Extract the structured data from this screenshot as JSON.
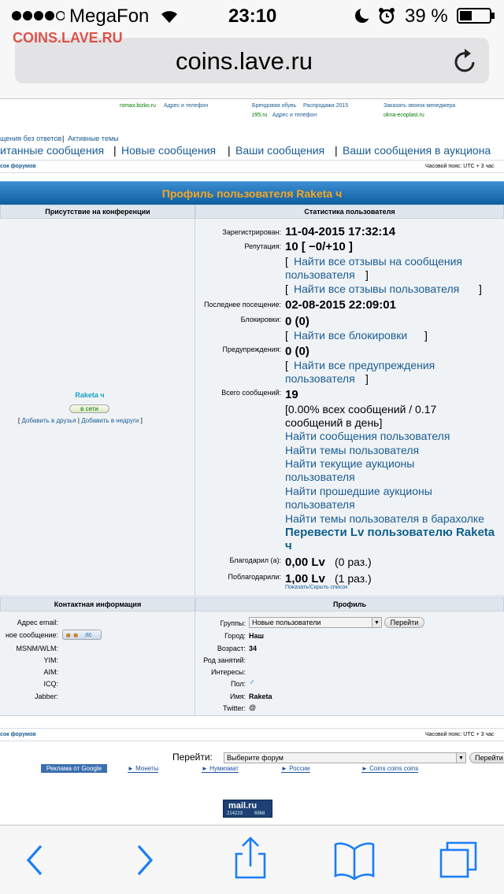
{
  "status_bar": {
    "carrier": "MegaFon",
    "time": "23:10",
    "battery": "39 %"
  },
  "site_watermark": "COINS.LAVE.RU",
  "url": "coins.lave.ru",
  "ads": {
    "col1_line1": "romax.bizko.ru",
    "col1_line1b": "Адрес и телефон",
    "col2_line1": "Брендовая обувь",
    "col2_line1b": "Распродажа 2015",
    "col2_line2": "z95.ru",
    "col2_line2b": "Адрес и телефон",
    "col3_line1": "Заказать звонок менеджера",
    "col3_line2": "okna-ecoplast.ru"
  },
  "nav": {
    "small_links": [
      "щения без ответов",
      "Активные темы"
    ],
    "big_links": [
      "итанные сообщения",
      "Новые сообщения",
      "Ваши сообщения",
      "Ваши сообщения в аукциона"
    ],
    "forum_list": "сок форумов",
    "timezone": "Часовой пояс: UTC + 3 час"
  },
  "profile": {
    "banner": "Профиль пользователя Raketa ч",
    "col_left_header": "Присутствие на конференции",
    "col_right_header": "Статистика пользователя",
    "username": "Raketa ч",
    "online_button": "в сети",
    "add_friend": "Добавить в друзья",
    "add_foe": "Добавить в недруги"
  },
  "stats": {
    "registered_label": "Зарегистрирован:",
    "registered_value": "11-04-2015 17:32:14",
    "reputation_label": "Репутация:",
    "reputation_value": "10 [ −0/+10 ]",
    "rep_link1_a": "Найти все отзывы на сообщения",
    "rep_link1_b": "пользователя",
    "rep_link2": "Найти все отзывы пользователя",
    "last_visit_label": "Последнее посещение:",
    "last_visit_value": "02-08-2015 22:09:01",
    "bans_label": "Блокировки:",
    "bans_value": "0 (0)",
    "bans_link": "Найти все блокировки",
    "warnings_label": "Предупреждения:",
    "warnings_value": "0 (0)",
    "warn_link_a": "Найти все предупреждения",
    "warn_link_b": "пользователя",
    "posts_label": "Всего сообщений:",
    "posts_value": "19",
    "posts_pct_a": "[0.00% всех сообщений / 0.17",
    "posts_pct_b": "сообщений в день]",
    "find_posts": "Найти сообщения пользователя",
    "find_topics": "Найти темы пользователя",
    "find_cur_auctions_a": "Найти текущие аукционы",
    "find_cur_auctions_b": "пользователя",
    "find_past_auctions_a": "Найти прошедшие аукционы",
    "find_past_auctions_b": "пользователя",
    "find_flea": "Найти темы пользователя в барахолке",
    "transfer_a": "Перевести Lv пользователю Raketa",
    "transfer_b": "ч",
    "thanked_label": "Благодарил (а):",
    "thanked_value": "0,00 Lv",
    "thanked_count": "(0 раз.)",
    "was_thanked_label": "Поблагодарили:",
    "was_thanked_value": "1,00 Lv",
    "was_thanked_count": "(1 раз.)",
    "show_hide": "Показать/Скрыть список"
  },
  "contact": {
    "header": "Контактная информация",
    "email": "Адрес email:",
    "pm": "ное сообщение:",
    "pm_button": "лс",
    "msnm": "MSNM/WLM:",
    "yim": "YIM:",
    "aim": "AIM:",
    "icq": "ICQ:",
    "jabber": "Jabber:"
  },
  "profile_info": {
    "header": "Профиль",
    "groups_label": "Группы:",
    "groups_value": "Новые пользователи",
    "go_button": "Перейти",
    "city_label": "Город:",
    "city_value": "Наш",
    "age_label": "Возраст:",
    "age_value": "34",
    "occupation_label": "Род занятий:",
    "interests_label": "Интересы:",
    "gender_label": "Пол:",
    "name_label": "Имя:",
    "name_value": "Raketa",
    "twitter_label": "Twitter:"
  },
  "footer": {
    "forum_list": "сок форумов",
    "timezone": "Часовой пояс: UTC + 3 час",
    "jump_label": "Перейти:",
    "jump_select": "Выберите форум",
    "jump_button": "Перейти",
    "google_ads": "Реклама от Google",
    "ad_links": [
      "► Монеты",
      "► Нумизмат",
      "► России",
      "► Coins coins coins"
    ],
    "mailru": "mail.ru",
    "mailru_counter_1": "214223",
    "mailru_counter_2": "6968"
  }
}
